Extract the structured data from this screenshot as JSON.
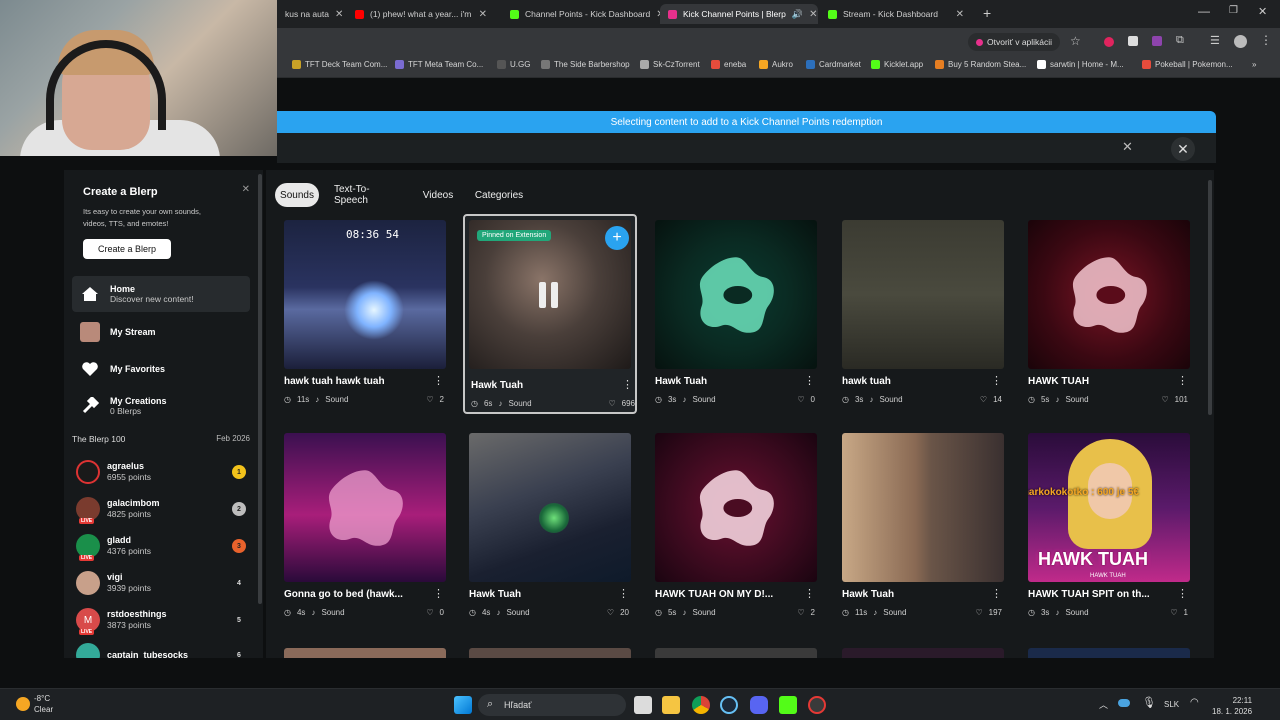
{
  "browser": {
    "tabs": [
      {
        "label": "kus na auta",
        "fav": "#8a8a8a"
      },
      {
        "label": "(1) phew! what a year... i'm",
        "fav": "#ff0000"
      },
      {
        "label": "Channel Points - Kick Dashboard",
        "fav": "#53fc18"
      },
      {
        "label": "Kick Channel Points | Blerp",
        "fav": "#e8308c"
      },
      {
        "label": "Stream - Kick Dashboard",
        "fav": "#53fc18"
      }
    ],
    "new_tab": "+",
    "open_in_app": "Otvoriť v aplikácii",
    "bookmarks": [
      "TFT Deck Team Com...",
      "TFT Meta Team Co...",
      "U.GG",
      "The Side Barbershop",
      "Sk-CzTorrent",
      "eneba",
      "Aukro",
      "Cardmarket",
      "Kicklet.app",
      "Buy 5 Random Stea...",
      "sarwtin | Home - M...",
      "Pokeball | Pokemon..."
    ]
  },
  "banner": "Selecting content to add to a Kick Channel Points redemption",
  "sidebar": {
    "create": {
      "title": "Create a Blerp",
      "desc": "Its easy to create your own sounds, videos, TTS, and emotes!",
      "button": "Create a Blerp"
    },
    "nav": [
      {
        "t1": "Home",
        "t2": "Discover new content!"
      },
      {
        "t1": "My Stream",
        "t2": ""
      },
      {
        "t1": "My Favorites",
        "t2": ""
      },
      {
        "t1": "My Creations",
        "t2": "0 Blerps"
      }
    ],
    "blerp100": {
      "title": "The Blerp 100",
      "date": "Feb 2026"
    },
    "ranks": [
      {
        "name": "agraelus",
        "points": "6955 points",
        "rank": "1",
        "color": "#d33"
      },
      {
        "name": "galacimbom",
        "points": "4825 points",
        "rank": "2",
        "color": "#a33"
      },
      {
        "name": "gladd",
        "points": "4376 points",
        "rank": "3",
        "color": "#1a8f4a"
      },
      {
        "name": "vigi",
        "points": "3939 points",
        "rank": "4",
        "color": "#b98a6a"
      },
      {
        "name": "rstdoesthings",
        "points": "3873 points",
        "rank": "5",
        "color": "#d84a4a"
      },
      {
        "name": "captain_tubesocks",
        "points": "",
        "rank": "6",
        "color": "#3a9"
      }
    ]
  },
  "content": {
    "tabs": [
      "Sounds",
      "Text-To-Speech",
      "Videos",
      "Categories"
    ],
    "pinned_label": "Pinned on Extension",
    "tiles": [
      {
        "title": "hawk tuah hawk tuah",
        "duration": "11s",
        "type": "Sound",
        "likes": "2"
      },
      {
        "title": "Hawk Tuah",
        "duration": "6s",
        "type": "Sound",
        "likes": "696"
      },
      {
        "title": "Hawk Tuah",
        "duration": "3s",
        "type": "Sound",
        "likes": "0"
      },
      {
        "title": "hawk tuah",
        "duration": "3s",
        "type": "Sound",
        "likes": "14"
      },
      {
        "title": "HAWK TUAH",
        "duration": "5s",
        "type": "Sound",
        "likes": "101"
      },
      {
        "title": "Gonna go to bed (hawk...",
        "duration": "4s",
        "type": "Sound",
        "likes": "0"
      },
      {
        "title": "Hawk Tuah",
        "duration": "4s",
        "type": "Sound",
        "likes": "20"
      },
      {
        "title": "HAWK TUAH ON MY D!...",
        "duration": "5s",
        "type": "Sound",
        "likes": "2"
      },
      {
        "title": "Hawk Tuah",
        "duration": "11s",
        "type": "Sound",
        "likes": "197"
      },
      {
        "title": "HAWK TUAH SPIT on th...",
        "duration": "3s",
        "type": "Sound",
        "likes": "1"
      }
    ],
    "thumb_text": {
      "game_timer": "08:36 54",
      "overlay_alert": "markokokotko : 600 je 5€",
      "hawk_tuah_art": "HAWK TUAH",
      "hawk_tuah_art_sub": "HAWK TUAH"
    }
  },
  "taskbar": {
    "temp": "-8°C",
    "weather": "Clear",
    "search": "Hľadať",
    "lang": "SLK",
    "time": "22:11",
    "date": "18. 1. 2026"
  }
}
